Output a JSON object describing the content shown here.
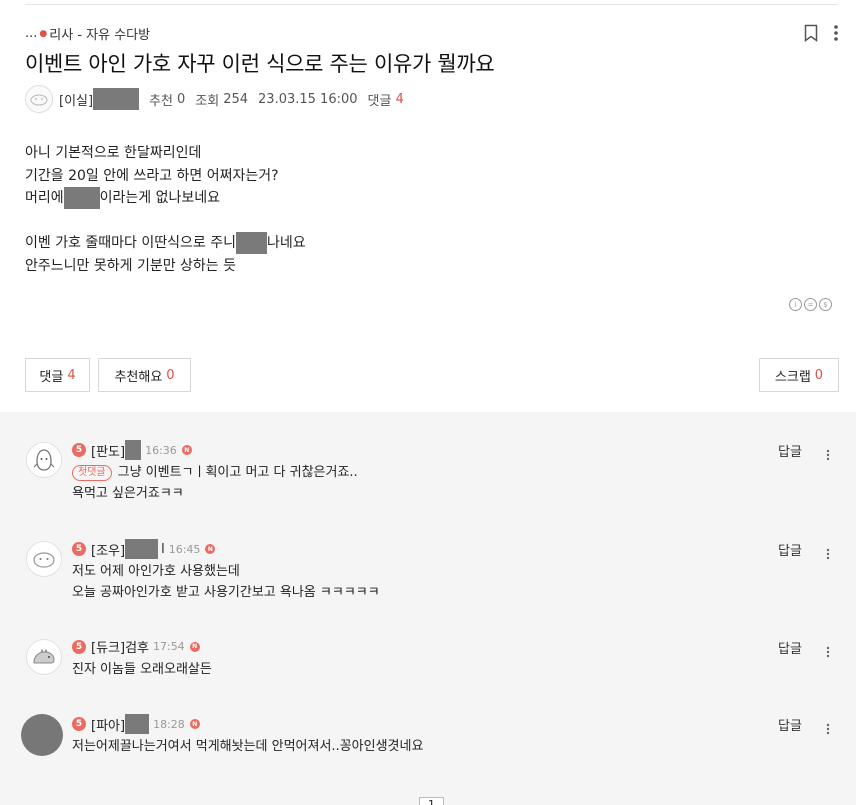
{
  "board": {
    "ellipsis": "...",
    "dot": "●",
    "name": "리사 - 자유 수다방"
  },
  "post": {
    "title": "이벤트 아인 가호 자꾸 이런 식으로 주는 이유가 뭘까요",
    "author_prefix": "[이실]",
    "recommend_label": "추천",
    "recommend_count": "0",
    "views_label": "조회",
    "views_count": "254",
    "date": "23.03.15 16:00",
    "comments_label": "댓글",
    "comments_count": "4",
    "lines": {
      "l1": "아니 기본적으로 한달짜리인데",
      "l2": "기간을 20일 안에 쓰라고 하면 어쩌자는거?",
      "l3a": "머리에",
      "l3b": "이라는게 없나보네요",
      "l5a": "이벤 가호 줄때마다 이딴식으로 주니",
      "l5b": "나네요",
      "l6": "안주느니만 못하게 기분만 상하는 듯"
    }
  },
  "buttons": {
    "comment_label": "댓글",
    "comment_count": "4",
    "recommend_label": "추천해요",
    "recommend_count": "0",
    "scrap_label": "스크랩",
    "scrap_count": "0"
  },
  "comments": [
    {
      "level": "5",
      "name": "[판도]",
      "time": "16:36",
      "new": "N",
      "tag": "첫댓글",
      "text1": "그냥 이벤트ㄱㅣ획이고 머고 다 귀찮은거죠..",
      "text2": "욕먹고 싶은거죠ㅋㅋ",
      "reply": "답글"
    },
    {
      "level": "5",
      "name": "[조우]",
      "name_suffix": "l",
      "time": "16:45",
      "new": "N",
      "text1": "저도 어제 아인가호 사용했는데",
      "text2": "오늘 공짜아인가호 받고 사용기간보고 욕나옴 ㅋㅋㅋㅋㅋ",
      "reply": "답글"
    },
    {
      "level": "5",
      "name": "[듀크]검후",
      "time": "17:54",
      "new": "N",
      "text1": "진자 이놈들 오래오래살든",
      "reply": "답글"
    },
    {
      "level": "5",
      "name": "[파아]",
      "time": "18:28",
      "new": "N",
      "text1": "저는어제끌나는거여서 먹게해놧는데 안먹어져서..꽁아인생겻네요",
      "reply": "답글"
    }
  ],
  "pager": {
    "current": "1"
  },
  "colors": {
    "accent": "#e0504b",
    "level": "#e96b62",
    "comment_bg": "#f5f5f5"
  }
}
